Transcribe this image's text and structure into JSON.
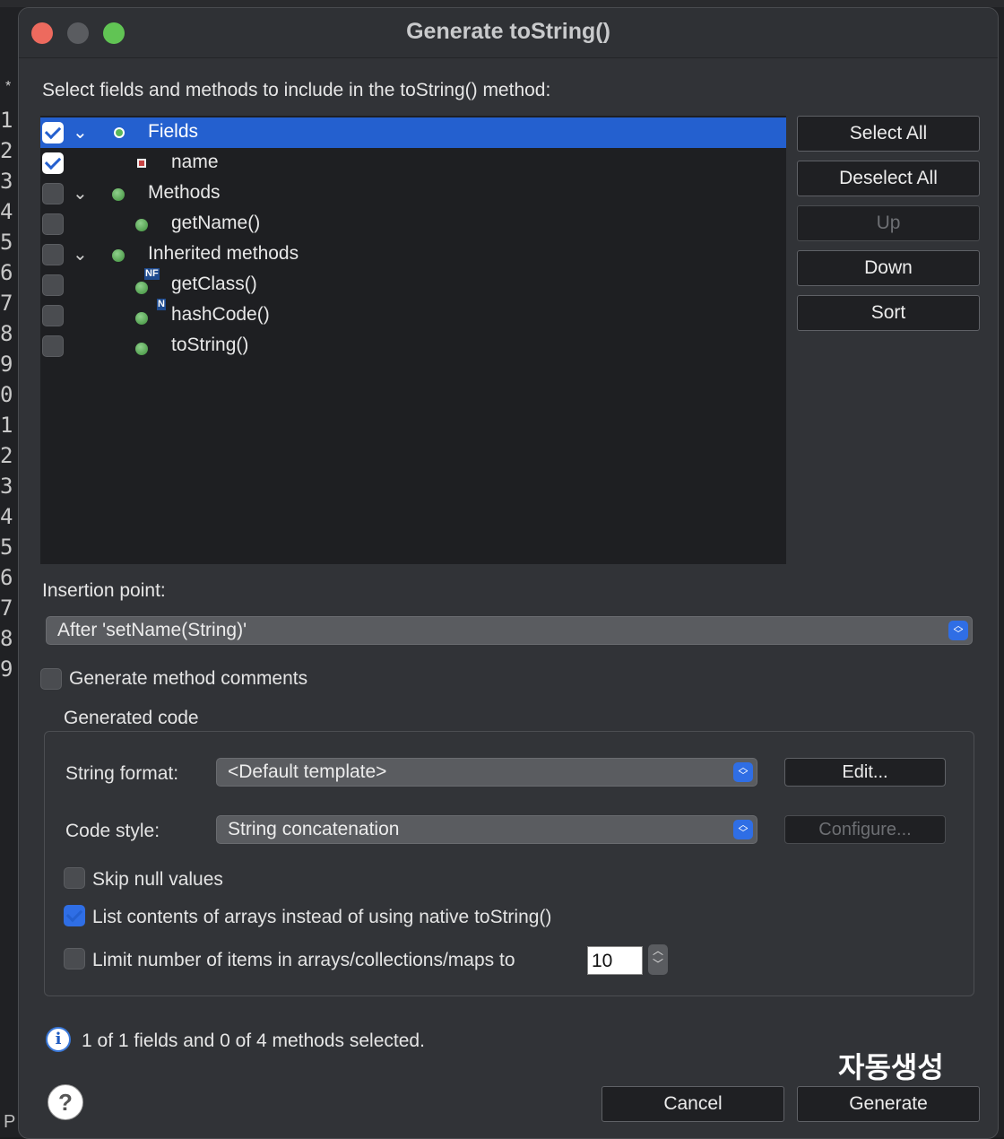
{
  "background": {
    "star": "*",
    "gutter_numbers": [
      "1",
      "2",
      "3",
      "4",
      "5",
      "6",
      "7",
      "8",
      "9",
      "0",
      "1",
      "2",
      "3",
      "4",
      "5",
      "6",
      "7",
      "8",
      "9"
    ],
    "status_letter": "P"
  },
  "dialog": {
    "title": "Generate toString()",
    "instruction": "Select fields and methods to include in the toString() method:"
  },
  "tree": {
    "rows": [
      {
        "label": "Fields",
        "checked": true,
        "icon": "field-group-icon",
        "selected": true
      },
      {
        "label": "name",
        "checked": true,
        "icon": "private-field-icon"
      },
      {
        "label": "Methods",
        "checked": false,
        "icon": "method-group-icon"
      },
      {
        "label": "getName()",
        "checked": false,
        "icon": "public-method-icon"
      },
      {
        "label": "Inherited methods",
        "checked": false,
        "icon": "method-group-icon"
      },
      {
        "label": "getClass()",
        "checked": false,
        "icon": "public-method-icon",
        "overlay": "NF"
      },
      {
        "label": "hashCode()",
        "checked": false,
        "icon": "public-method-icon",
        "overlay": "N"
      },
      {
        "label": "toString()",
        "checked": false,
        "icon": "public-method-icon"
      }
    ]
  },
  "side_buttons": {
    "select_all": "Select All",
    "deselect_all": "Deselect All",
    "up": "Up",
    "down": "Down",
    "sort": "Sort"
  },
  "insertion": {
    "label": "Insertion point:",
    "value": "After 'setName(String)'"
  },
  "method_comments": {
    "label": "Generate method comments",
    "checked": false
  },
  "generated_code": {
    "title": "Generated code",
    "string_format_label": "String format:",
    "string_format_value": "<Default template>",
    "edit_button": "Edit...",
    "code_style_label": "Code style:",
    "code_style_value": "String concatenation",
    "configure_button": "Configure...",
    "skip_null_label": "Skip null values",
    "skip_null_checked": false,
    "list_arrays_label": "List contents of arrays instead of using native toString()",
    "list_arrays_checked": true,
    "limit_label": "Limit number of items in arrays/collections/maps to",
    "limit_checked": false,
    "limit_value": "10"
  },
  "status": {
    "message": "1 of 1 fields and 0 of 4 methods selected."
  },
  "annotation": "자동생성",
  "footer": {
    "help": "?",
    "cancel": "Cancel",
    "generate": "Generate"
  },
  "colors": {
    "selection": "#2460cf",
    "dialog_bg": "#313337",
    "tree_bg": "#1e1f22",
    "close": "#ed6a5e",
    "maximize": "#61c454"
  }
}
